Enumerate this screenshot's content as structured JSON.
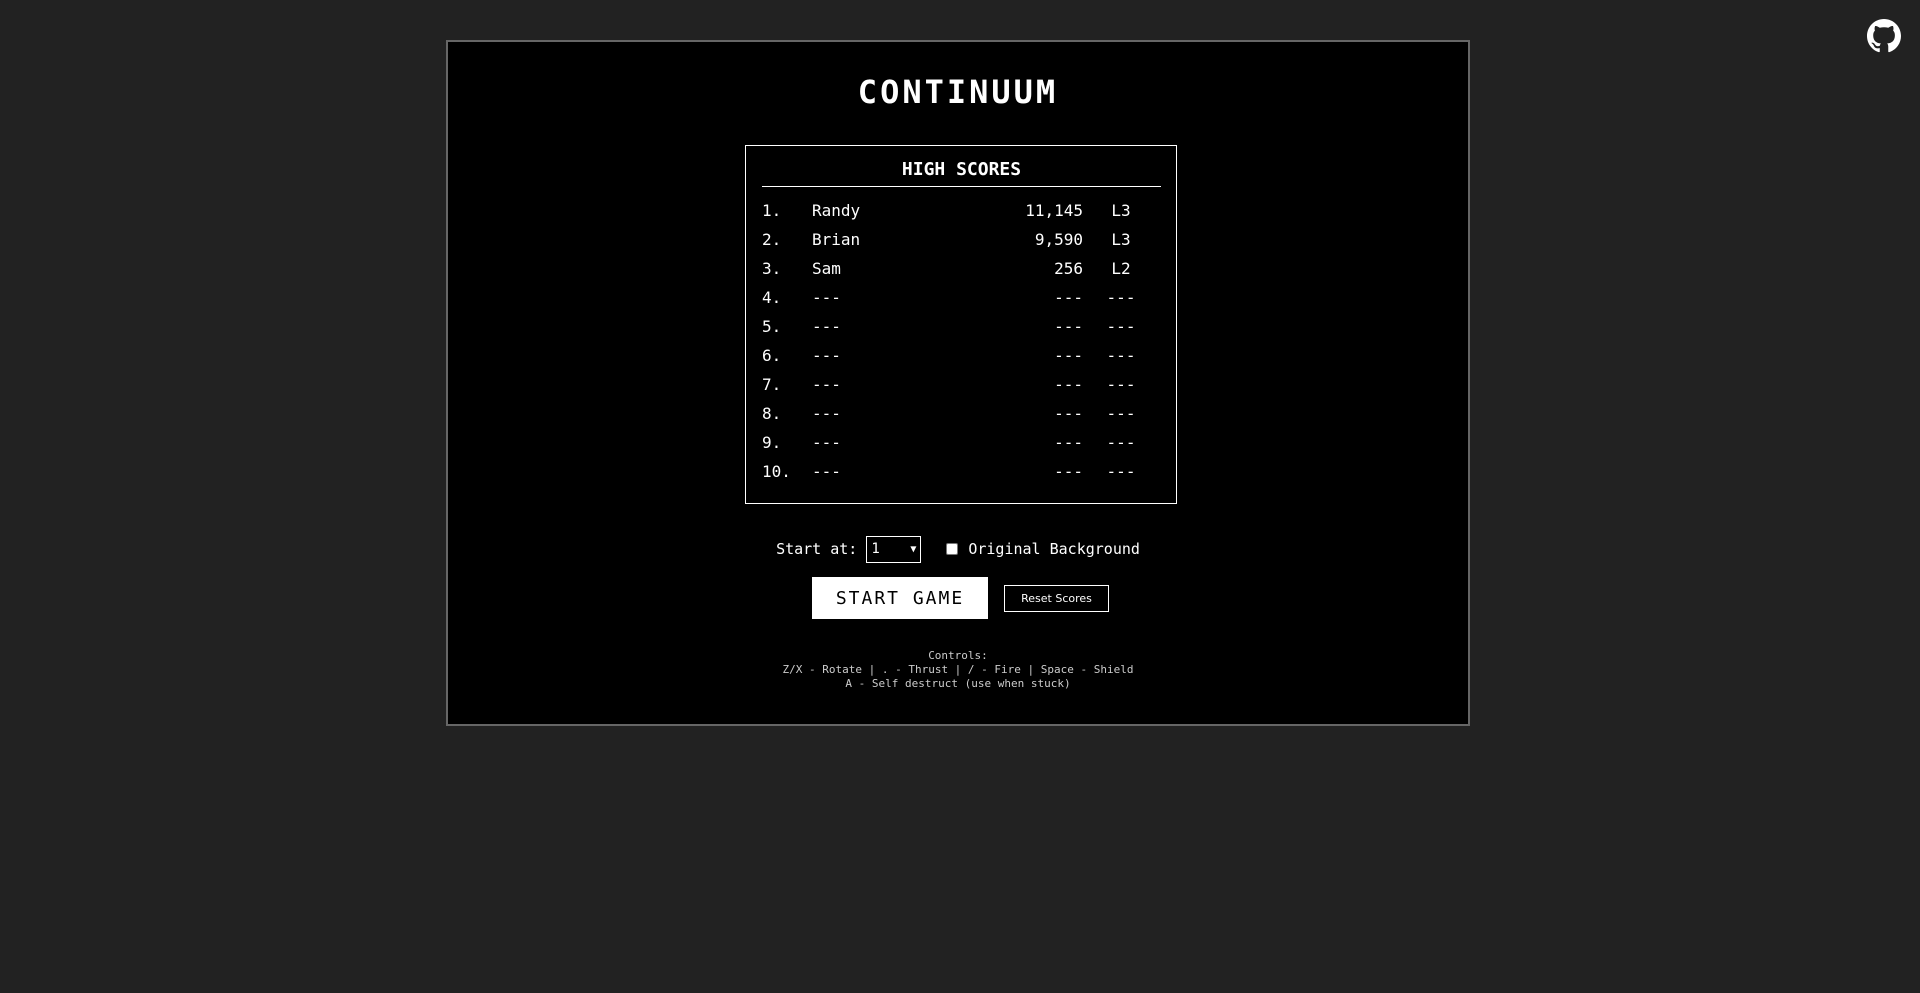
{
  "github": {
    "icon": "github-icon"
  },
  "title": "CONTINUUM",
  "high_scores": {
    "heading": "HIGH SCORES",
    "rows": [
      {
        "rank": "1.",
        "name": "Randy",
        "score": "11,145",
        "level": "L3"
      },
      {
        "rank": "2.",
        "name": "Brian",
        "score": "9,590",
        "level": "L3"
      },
      {
        "rank": "3.",
        "name": "Sam",
        "score": "256",
        "level": "L2"
      },
      {
        "rank": "4.",
        "name": "---",
        "score": "---",
        "level": "---"
      },
      {
        "rank": "5.",
        "name": "---",
        "score": "---",
        "level": "---"
      },
      {
        "rank": "6.",
        "name": "---",
        "score": "---",
        "level": "---"
      },
      {
        "rank": "7.",
        "name": "---",
        "score": "---",
        "level": "---"
      },
      {
        "rank": "8.",
        "name": "---",
        "score": "---",
        "level": "---"
      },
      {
        "rank": "9.",
        "name": "---",
        "score": "---",
        "level": "---"
      },
      {
        "rank": "10.",
        "name": "---",
        "score": "---",
        "level": "---"
      }
    ]
  },
  "options": {
    "start_label": "Start at:",
    "start_level_value": "1",
    "original_background_label": "Original Background",
    "original_background_checked": false
  },
  "buttons": {
    "start": "START GAME",
    "reset": "Reset Scores"
  },
  "controls": {
    "heading": "Controls:",
    "line1": "Z/X - Rotate | . - Thrust | / - Fire | Space - Shield",
    "line2": "A - Self destruct (use when stuck)"
  },
  "colors": {
    "page_background": "#222222",
    "panel_background": "#000000",
    "foreground": "#ffffff"
  }
}
